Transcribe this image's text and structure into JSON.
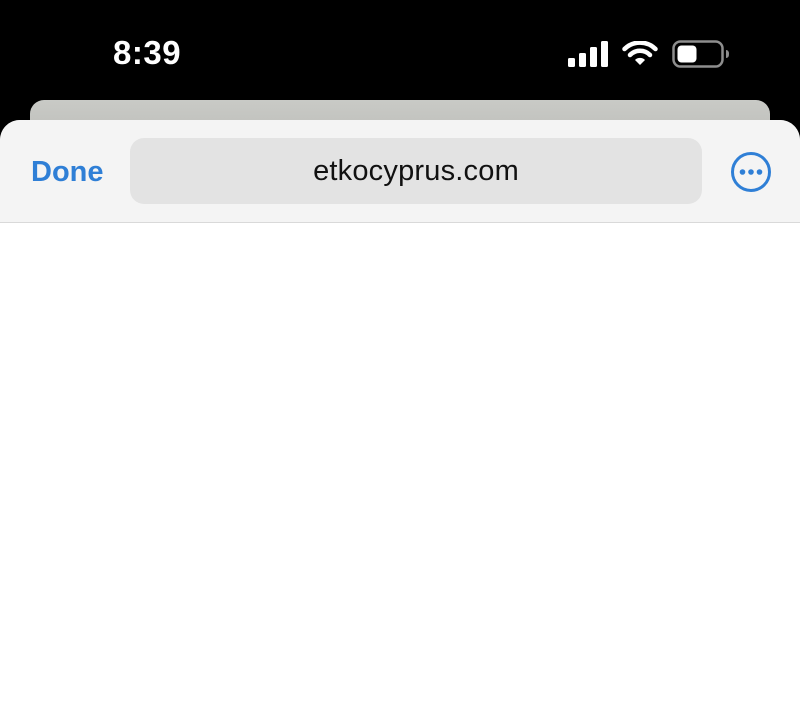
{
  "status_bar": {
    "time": "8:39",
    "icons": [
      "cellular-signal-icon",
      "wifi-icon",
      "battery-icon"
    ]
  },
  "toolbar": {
    "done_label": "Done",
    "url": "etkocyprus.com",
    "more_icon": "ellipsis-circle-icon"
  },
  "colors": {
    "accent": "#2f7fd6",
    "toolbar_bg": "#f4f4f4",
    "url_field_bg": "#e3e3e3",
    "status_bar_bg": "#000000"
  }
}
